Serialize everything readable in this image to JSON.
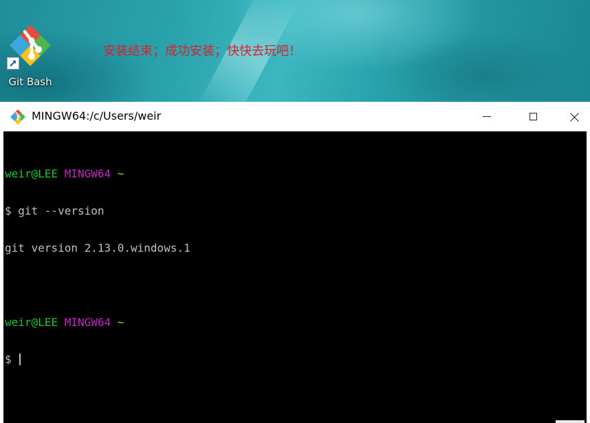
{
  "desktop": {
    "icon_label": "Git Bash",
    "icon_name": "git-bash-icon",
    "annotation": "安装结束；成功安装；快快去玩吧！",
    "annotation_color": "#d8202b"
  },
  "window": {
    "title": "MINGW64:/c/Users/weir",
    "controls": {
      "minimize": "minimize-icon",
      "maximize": "maximize-icon",
      "close": "close-icon"
    }
  },
  "terminal": {
    "prompt1": {
      "user": "weir@LEE",
      "system": "MINGW64",
      "path": "~"
    },
    "command": "$ git --version",
    "output": "git version 2.13.0.windows.1",
    "prompt2": {
      "user": "weir@LEE",
      "system": "MINGW64",
      "path": "~"
    },
    "input_prefix": "$ ",
    "colors": {
      "background": "#000000",
      "user": "#21c331",
      "system": "#c329c3",
      "path": "#c2c22a",
      "text": "#c0c0c0"
    }
  }
}
